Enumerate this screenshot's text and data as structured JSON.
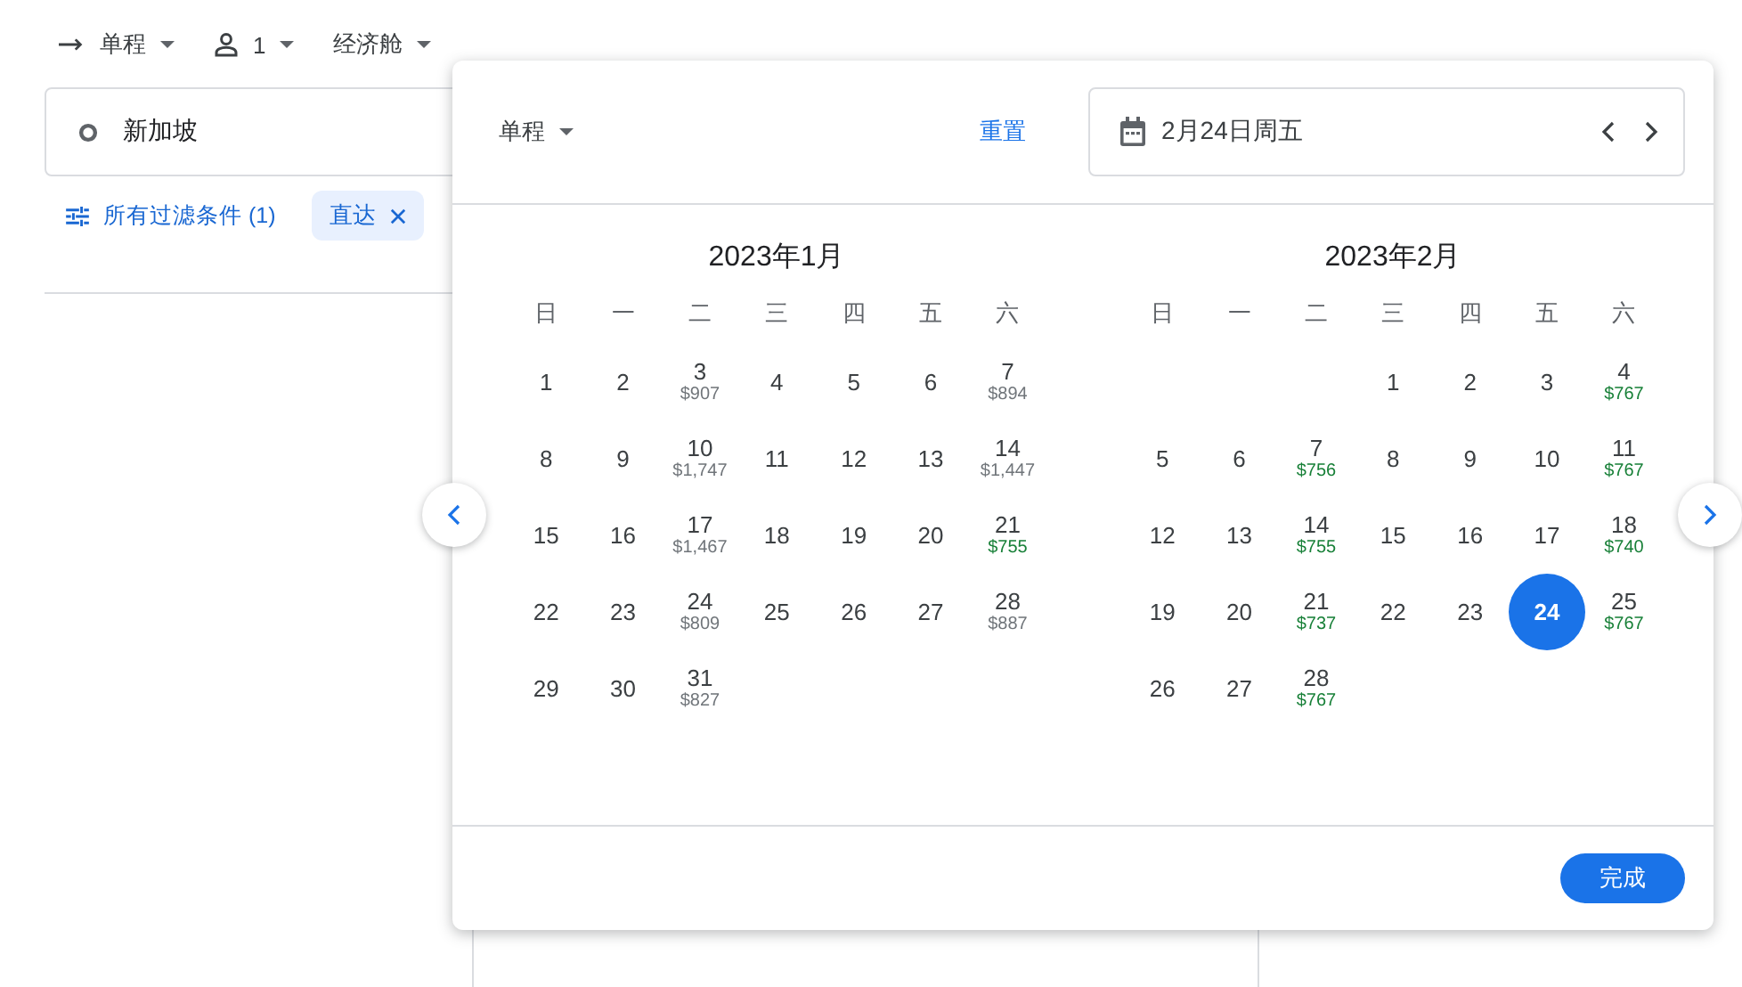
{
  "trip_bar": [
    {
      "kind": "trip",
      "label": "单程"
    },
    {
      "kind": "passengers",
      "label": "1"
    },
    {
      "kind": "cabin",
      "label": "经济舱"
    }
  ],
  "origin": {
    "value": "新加坡"
  },
  "filters": [
    {
      "kind": "all",
      "label": "所有过滤条件 (1)"
    },
    {
      "kind": "chip",
      "label": "直达"
    }
  ],
  "date_picker": {
    "trip_type": "单程",
    "reset": "重置",
    "date_field": {
      "value": "2月24日周五"
    },
    "months": [
      {
        "title": "2023年1月",
        "weekdays": [
          "日",
          "一",
          "二",
          "三",
          "四",
          "五",
          "六"
        ],
        "weeks": [
          [
            {
              "kind": "day",
              "day": "1",
              "selected": false
            },
            {
              "kind": "day",
              "day": "2",
              "selected": false
            },
            {
              "kind": "day",
              "day": "3",
              "price": "$907",
              "cheap": false,
              "selected": false
            },
            {
              "kind": "day",
              "day": "4",
              "selected": false
            },
            {
              "kind": "day",
              "day": "5",
              "selected": false
            },
            {
              "kind": "day",
              "day": "6",
              "selected": false
            },
            {
              "kind": "day",
              "day": "7",
              "price": "$894",
              "cheap": false,
              "selected": false
            }
          ],
          [
            {
              "kind": "day",
              "day": "8",
              "selected": false
            },
            {
              "kind": "day",
              "day": "9",
              "selected": false
            },
            {
              "kind": "day",
              "day": "10",
              "price": "$1,747",
              "cheap": false,
              "selected": false
            },
            {
              "kind": "day",
              "day": "11",
              "selected": false
            },
            {
              "kind": "day",
              "day": "12",
              "selected": false
            },
            {
              "kind": "day",
              "day": "13",
              "selected": false
            },
            {
              "kind": "day",
              "day": "14",
              "price": "$1,447",
              "cheap": false,
              "selected": false
            }
          ],
          [
            {
              "kind": "day",
              "day": "15",
              "selected": false
            },
            {
              "kind": "day",
              "day": "16",
              "selected": false
            },
            {
              "kind": "day",
              "day": "17",
              "price": "$1,467",
              "cheap": false,
              "selected": false
            },
            {
              "kind": "day",
              "day": "18",
              "selected": false
            },
            {
              "kind": "day",
              "day": "19",
              "selected": false
            },
            {
              "kind": "day",
              "day": "20",
              "selected": false
            },
            {
              "kind": "day",
              "day": "21",
              "price": "$755",
              "cheap": true,
              "selected": false
            }
          ],
          [
            {
              "kind": "day",
              "day": "22",
              "selected": false
            },
            {
              "kind": "day",
              "day": "23",
              "selected": false
            },
            {
              "kind": "day",
              "day": "24",
              "price": "$809",
              "cheap": false,
              "selected": false
            },
            {
              "kind": "day",
              "day": "25",
              "selected": false
            },
            {
              "kind": "day",
              "day": "26",
              "selected": false
            },
            {
              "kind": "day",
              "day": "27",
              "selected": false
            },
            {
              "kind": "day",
              "day": "28",
              "price": "$887",
              "cheap": false,
              "selected": false
            }
          ],
          [
            {
              "kind": "day",
              "day": "29",
              "selected": false
            },
            {
              "kind": "day",
              "day": "30",
              "selected": false
            },
            {
              "kind": "day",
              "day": "31",
              "price": "$827",
              "cheap": false,
              "selected": false
            }
          ]
        ]
      },
      {
        "title": "2023年2月",
        "weekdays": [
          "日",
          "一",
          "二",
          "三",
          "四",
          "五",
          "六"
        ],
        "weeks": [
          [
            {
              "kind": "blank"
            },
            {
              "kind": "blank"
            },
            {
              "kind": "blank"
            },
            {
              "kind": "day",
              "day": "1",
              "selected": false
            },
            {
              "kind": "day",
              "day": "2",
              "selected": false
            },
            {
              "kind": "day",
              "day": "3",
              "selected": false
            },
            {
              "kind": "day",
              "day": "4",
              "price": "$767",
              "cheap": true,
              "selected": false
            }
          ],
          [
            {
              "kind": "day",
              "day": "5",
              "selected": false
            },
            {
              "kind": "day",
              "day": "6",
              "selected": false
            },
            {
              "kind": "day",
              "day": "7",
              "price": "$756",
              "cheap": true,
              "selected": false
            },
            {
              "kind": "day",
              "day": "8",
              "selected": false
            },
            {
              "kind": "day",
              "day": "9",
              "selected": false
            },
            {
              "kind": "day",
              "day": "10",
              "selected": false
            },
            {
              "kind": "day",
              "day": "11",
              "price": "$767",
              "cheap": true,
              "selected": false
            }
          ],
          [
            {
              "kind": "day",
              "day": "12",
              "selected": false
            },
            {
              "kind": "day",
              "day": "13",
              "selected": false
            },
            {
              "kind": "day",
              "day": "14",
              "price": "$755",
              "cheap": true,
              "selected": false
            },
            {
              "kind": "day",
              "day": "15",
              "selected": false
            },
            {
              "kind": "day",
              "day": "16",
              "selected": false
            },
            {
              "kind": "day",
              "day": "17",
              "selected": false
            },
            {
              "kind": "day",
              "day": "18",
              "price": "$740",
              "cheap": true,
              "selected": false
            }
          ],
          [
            {
              "kind": "day",
              "day": "19",
              "selected": false
            },
            {
              "kind": "day",
              "day": "20",
              "selected": false
            },
            {
              "kind": "day",
              "day": "21",
              "price": "$737",
              "cheap": true,
              "selected": false
            },
            {
              "kind": "day",
              "day": "22",
              "selected": false
            },
            {
              "kind": "day",
              "day": "23",
              "selected": false
            },
            {
              "kind": "day",
              "day": "24",
              "selected": true
            },
            {
              "kind": "day",
              "day": "25",
              "price": "$767",
              "cheap": true,
              "selected": false
            }
          ],
          [
            {
              "kind": "day",
              "day": "26",
              "selected": false
            },
            {
              "kind": "day",
              "day": "27",
              "selected": false
            },
            {
              "kind": "day",
              "day": "28",
              "price": "$767",
              "cheap": true,
              "selected": false
            }
          ]
        ]
      }
    ],
    "done": "完成"
  }
}
